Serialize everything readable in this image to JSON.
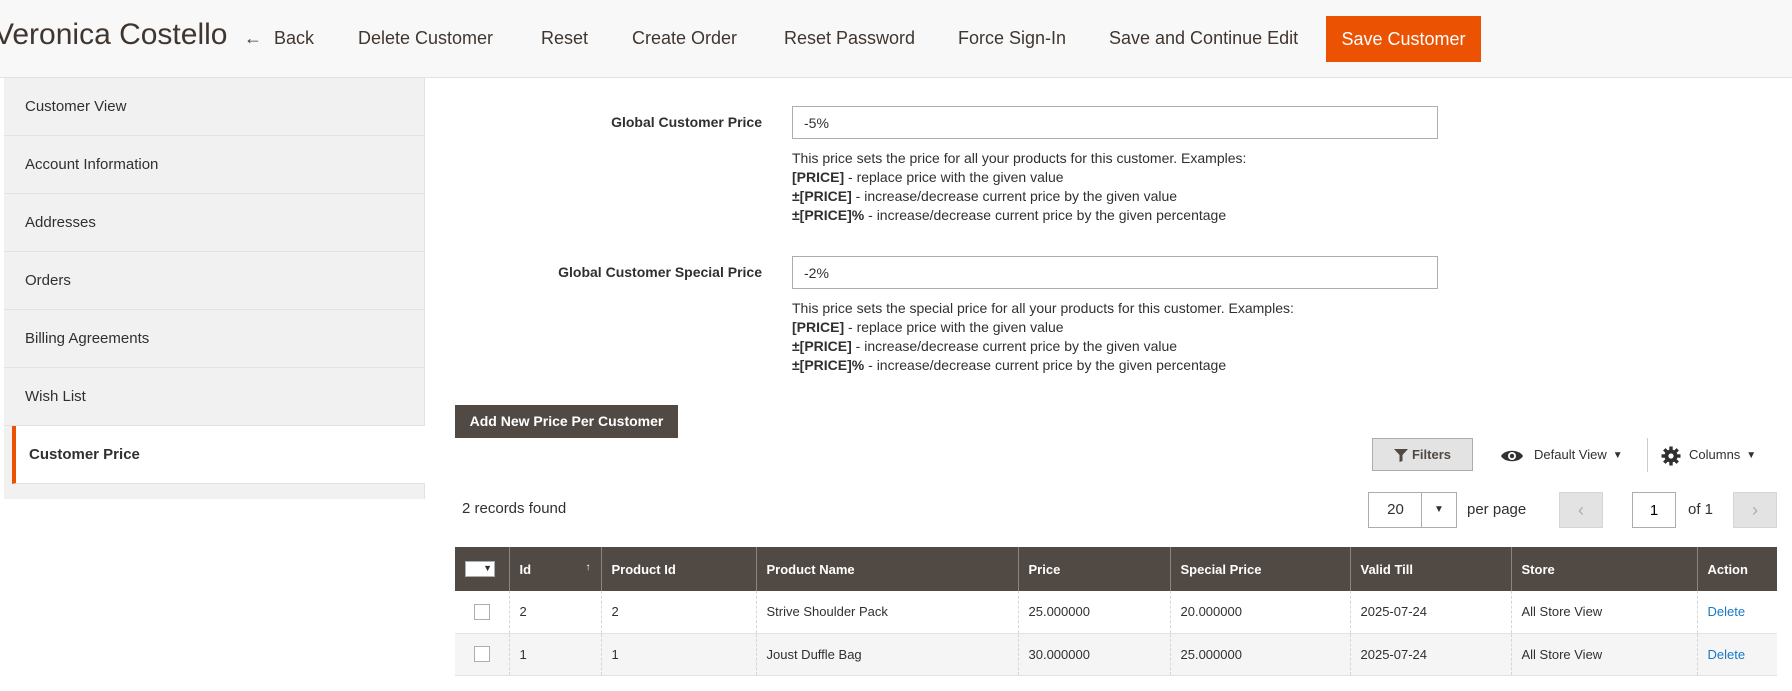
{
  "header": {
    "title": "Veronica Costello",
    "back": "Back",
    "delete_customer": "Delete Customer",
    "reset": "Reset",
    "create_order": "Create Order",
    "reset_password": "Reset Password",
    "force_sign_in": "Force Sign-In",
    "save_continue": "Save and Continue Edit",
    "save_customer": "Save Customer"
  },
  "sidebar": {
    "items": [
      {
        "label": "Customer View"
      },
      {
        "label": "Account Information"
      },
      {
        "label": "Addresses"
      },
      {
        "label": "Orders"
      },
      {
        "label": "Billing Agreements"
      },
      {
        "label": "Wish List"
      },
      {
        "label": "Customer Price",
        "active": true
      }
    ]
  },
  "form": {
    "global_price": {
      "label": "Global Customer Price",
      "value": "-5%",
      "note_intro": "This price sets the price for all your products for this customer. Examples:",
      "line1_code": "[PRICE]",
      "line1_text": " - replace price with the given value",
      "line2_code": "±[PRICE]",
      "line2_text": " - increase/decrease current price by the given value",
      "line3_code": "±[PRICE]%",
      "line3_text": " - increase/decrease current price by the given percentage"
    },
    "global_special_price": {
      "label": "Global Customer Special Price",
      "value": "-2%",
      "note_intro": "This price sets the special price for all your products for this customer. Examples:",
      "line1_code": "[PRICE]",
      "line1_text": " - replace price with the given value",
      "line2_code": "±[PRICE]",
      "line2_text": " - increase/decrease current price by the given value",
      "line3_code": "±[PRICE]%",
      "line3_text": " - increase/decrease current price by the given percentage"
    },
    "add_button": "Add New Price Per Customer"
  },
  "toolbar": {
    "filters": "Filters",
    "view": "Default View",
    "columns": "Columns",
    "records_found": "2 records found",
    "per_page_value": "20",
    "per_page_label": "per page",
    "page_value": "1",
    "page_of": "of 1"
  },
  "table": {
    "headers": [
      "Id",
      "Product Id",
      "Product Name",
      "Price",
      "Special Price",
      "Valid Till",
      "Store",
      "Action"
    ],
    "rows": [
      {
        "id": "2",
        "product_id": "2",
        "product_name": "Strive Shoulder Pack",
        "price": "25.000000",
        "special_price": "20.000000",
        "valid_till": "2025-07-24",
        "store": "All Store View",
        "action": "Delete"
      },
      {
        "id": "1",
        "product_id": "1",
        "product_name": "Joust Duffle Bag",
        "price": "30.000000",
        "special_price": "25.000000",
        "valid_till": "2025-07-24",
        "store": "All Store View",
        "action": "Delete"
      }
    ]
  },
  "colors": {
    "accent": "#eb5202",
    "dark_button": "#514943",
    "link": "#1979c3"
  },
  "icons": [
    "back-arrow-icon",
    "filter-icon",
    "eye-icon",
    "gear-icon",
    "caret-down-icon",
    "chevron-left-icon",
    "chevron-right-icon"
  ]
}
